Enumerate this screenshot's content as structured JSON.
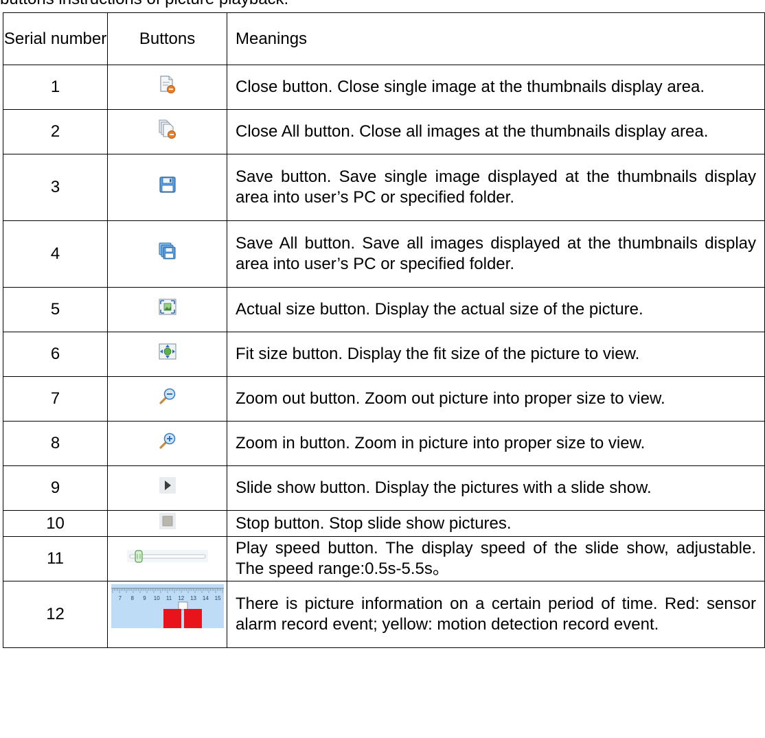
{
  "intro_text": "buttons instructions of picture playback:",
  "table": {
    "headers": {
      "serial": "Serial number",
      "buttons": "Buttons",
      "meanings": "Meanings"
    },
    "rows": [
      {
        "serial": "1",
        "icon": "close-single-icon",
        "meaning": "Close button. Close single image at the thumbnails display area."
      },
      {
        "serial": "2",
        "icon": "close-all-icon",
        "meaning": "Close All button. Close all images at the thumbnails display area."
      },
      {
        "serial": "3",
        "icon": "save-icon",
        "meaning": "Save button. Save single image displayed at the thumbnails display area into user’s PC or specified folder."
      },
      {
        "serial": "4",
        "icon": "save-all-icon",
        "meaning": "Save All button. Save all images displayed at the thumbnails display area into user’s PC or specified folder."
      },
      {
        "serial": "5",
        "icon": "actual-size-icon",
        "meaning": "Actual size button. Display the actual size of the picture."
      },
      {
        "serial": "6",
        "icon": "fit-size-icon",
        "meaning": "Fit size button. Display the fit size of the picture to view."
      },
      {
        "serial": "7",
        "icon": "zoom-out-icon",
        "meaning": "Zoom out button. Zoom out picture into proper size to view."
      },
      {
        "serial": "8",
        "icon": "zoom-in-icon",
        "meaning": "Zoom in button. Zoom in picture into proper size to view."
      },
      {
        "serial": "9",
        "icon": "play-icon",
        "meaning": "Slide show button. Display the pictures with a slide show."
      },
      {
        "serial": "10",
        "icon": "stop-icon",
        "meaning": "Stop button. Stop slide show pictures."
      },
      {
        "serial": "11",
        "icon": "speed-slider-icon",
        "meaning": "Play speed button. The display speed of the slide show, adjustable. The speed range:0.5s-5.5s。"
      },
      {
        "serial": "12",
        "icon": "timeline-icon",
        "meaning": "There is picture information on a certain period of time. Red: sensor alarm record event; yellow: motion detection record event."
      }
    ]
  },
  "timeline": {
    "ticks": [
      "7",
      "8",
      "9",
      "10",
      "11",
      "12",
      "13",
      "14",
      "15"
    ]
  },
  "colors": {
    "alarm_red": "#e8131b",
    "timeline_bg": "#bfdcf7",
    "icon_blue": "#3a7fc4",
    "icon_orange": "#e8802a"
  }
}
